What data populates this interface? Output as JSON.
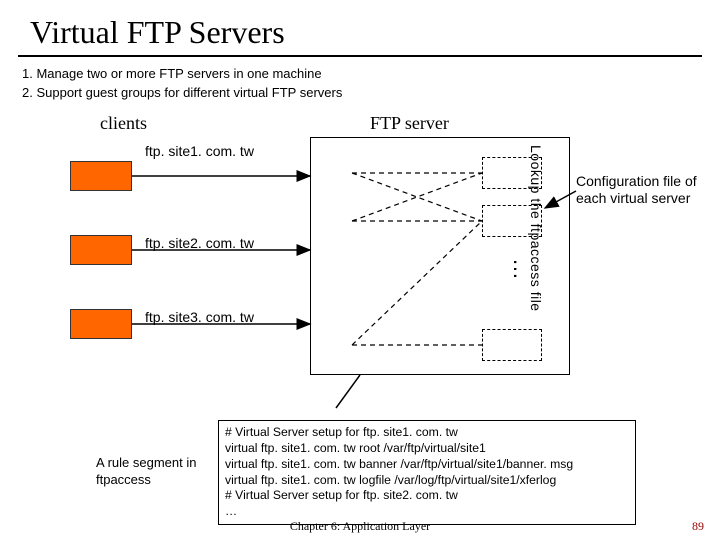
{
  "title": "Virtual FTP Servers",
  "intro": {
    "line1": "1. Manage two or more  FTP servers in one machine",
    "line2": "2. Support guest groups for different virtual FTP servers"
  },
  "headers": {
    "clients": "clients",
    "server": "FTP server"
  },
  "client_labels": {
    "c1": "ftp. site1. com. tw",
    "c2": "ftp. site2. com. tw",
    "c3": "ftp. site3. com. tw"
  },
  "lookup_label": "Lookup the ftpaccess file",
  "dots": "…",
  "config_label": "Configuration file of each virtual server",
  "rule_caption": "A rule segment in ftpaccess",
  "rule_box": "# Virtual Server setup for ftp. site1. com. tw\nvirtual ftp. site1. com. tw root /var/ftp/virtual/site1\nvirtual ftp. site1. com. tw banner /var/ftp/virtual/site1/banner. msg\nvirtual ftp. site1. com. tw logfile /var/log/ftp/virtual/site1/xferlog\n# Virtual Server setup for ftp. site2. com. tw\n…",
  "footer": "Chapter 6: Application Layer",
  "pagenum": "89"
}
